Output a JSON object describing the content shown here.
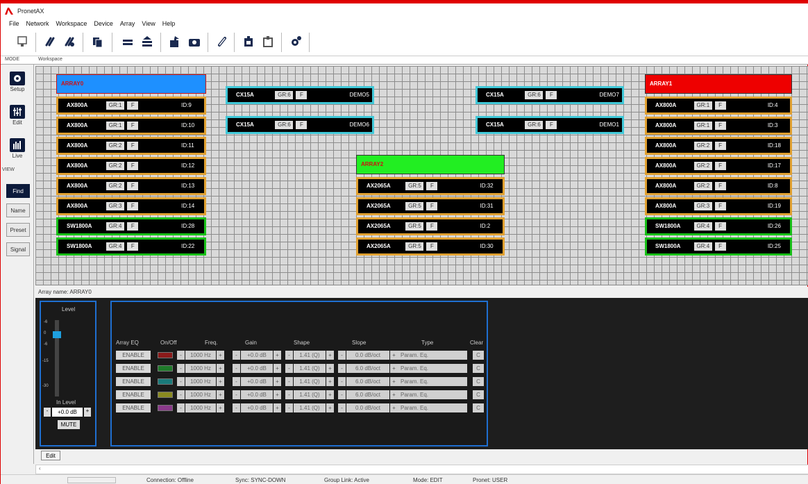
{
  "app": {
    "title": "PronetAX"
  },
  "menu": [
    "File",
    "Network",
    "Workspace",
    "Device",
    "Array",
    "View",
    "Help"
  ],
  "toolbar_icons": [
    "network-icon",
    "link-icon",
    "unlink-icon",
    "copy-icon",
    "stack-icon",
    "stack-up-icon",
    "export-icon",
    "camera-icon",
    "chain-icon",
    "device-icon",
    "device-out-icon",
    "settings-icon"
  ],
  "mode_label": "MODE",
  "workspace_label": "Workspace",
  "left": {
    "setup": "Setup",
    "edit": "Edit",
    "live": "Live",
    "view_label": "VIEW",
    "find": "Find",
    "name": "Name",
    "preset": "Preset",
    "signal": "Signal"
  },
  "arrays": {
    "array0": {
      "name": "ARRAY0",
      "color": "#1e90ff",
      "devices": [
        {
          "model": "AX800A",
          "gr": "GR:1",
          "f": "F",
          "id": "ID:9",
          "c": "or"
        },
        {
          "model": "AX800A",
          "gr": "GR:1",
          "f": "F",
          "id": "ID:10",
          "c": "or"
        },
        {
          "model": "AX800A",
          "gr": "GR:2",
          "f": "F",
          "id": "ID:11",
          "c": "or"
        },
        {
          "model": "AX800A",
          "gr": "GR:2",
          "f": "F",
          "id": "ID:12",
          "c": "or"
        },
        {
          "model": "AX800A",
          "gr": "GR:2",
          "f": "F",
          "id": "ID:13",
          "c": "or"
        },
        {
          "model": "AX800A",
          "gr": "GR:3",
          "f": "F",
          "id": "ID:14",
          "c": "or"
        },
        {
          "model": "SW1800A",
          "gr": "GR:4",
          "f": "F",
          "id": "ID:28",
          "c": "gn"
        },
        {
          "model": "SW1800A",
          "gr": "GR:4",
          "f": "F",
          "id": "ID:22",
          "c": "gn"
        }
      ]
    },
    "array1": {
      "name": "ARRAY1",
      "color": "#ee0000",
      "devices": [
        {
          "model": "AX800A",
          "gr": "GR:1",
          "f": "F",
          "id": "ID:4",
          "c": "or"
        },
        {
          "model": "AX800A",
          "gr": "GR:1",
          "f": "F",
          "id": "ID:3",
          "c": "or"
        },
        {
          "model": "AX800A",
          "gr": "GR:2",
          "f": "F",
          "id": "ID:18",
          "c": "or"
        },
        {
          "model": "AX800A",
          "gr": "GR:2",
          "f": "F",
          "id": "ID:17",
          "c": "or"
        },
        {
          "model": "AX800A",
          "gr": "GR:2",
          "f": "F",
          "id": "ID:8",
          "c": "or"
        },
        {
          "model": "AX800A",
          "gr": "GR:3",
          "f": "F",
          "id": "ID:19",
          "c": "or"
        },
        {
          "model": "SW1800A",
          "gr": "GR:4",
          "f": "F",
          "id": "ID:26",
          "c": "gn"
        },
        {
          "model": "SW1800A",
          "gr": "GR:4",
          "f": "F",
          "id": "ID:25",
          "c": "gn"
        }
      ]
    },
    "array2": {
      "name": "ARRAY2",
      "color": "#22ee22",
      "devices": [
        {
          "model": "AX2065A",
          "gr": "GR:5",
          "f": "F",
          "id": "ID:32",
          "c": "or"
        },
        {
          "model": "AX2065A",
          "gr": "GR:5",
          "f": "F",
          "id": "ID:31",
          "c": "or"
        },
        {
          "model": "AX2065A",
          "gr": "GR:5",
          "f": "F",
          "id": "ID:2",
          "c": "or"
        },
        {
          "model": "AX2065A",
          "gr": "GR:5",
          "f": "F",
          "id": "ID:30",
          "c": "or"
        }
      ]
    },
    "standalone": [
      {
        "model": "CX15A",
        "gr": "GR:6",
        "f": "F",
        "id": "DEMO5",
        "c": "cy"
      },
      {
        "model": "CX15A",
        "gr": "GR:6",
        "f": "F",
        "id": "DEMO6",
        "c": "cy"
      },
      {
        "model": "CX15A",
        "gr": "GR:6",
        "f": "F",
        "id": "DEMO7",
        "c": "cy"
      },
      {
        "model": "CX15A",
        "gr": "GR:6",
        "f": "F",
        "id": "DEMO1",
        "c": "cy"
      }
    ]
  },
  "array_name_label": "Array name: ARRAY0",
  "level": {
    "title": "Level",
    "scale": [
      "-6",
      "0",
      "-6",
      "-15",
      "-30"
    ],
    "in_level_label": "In Level",
    "in_level_value": "+0.0 dB",
    "mute": "MUTE",
    "minus": "-",
    "plus": "+"
  },
  "eq": {
    "headers": {
      "array_eq": "Array EQ",
      "onoff": "On/Off",
      "freq": "Freq.",
      "gain": "Gain",
      "shape": "Shape",
      "slope": "Slope",
      "type": "Type",
      "clear": "Clear"
    },
    "rows": [
      {
        "enable": "ENABLE",
        "color": "#8b1a1a",
        "freq": "1000 Hz",
        "gain": "+0.0 dB",
        "shape": "1.41 (Q)",
        "slope": "0.0 dB/oct",
        "type": "Param. Eq.",
        "clear": "C"
      },
      {
        "enable": "ENABLE",
        "color": "#1f7a2a",
        "freq": "1000 Hz",
        "gain": "+0.0 dB",
        "shape": "1.41 (Q)",
        "slope": "6.0 dB/oct",
        "type": "Param. Eq.",
        "clear": "C"
      },
      {
        "enable": "ENABLE",
        "color": "#1a7a7a",
        "freq": "1000 Hz",
        "gain": "+0.0 dB",
        "shape": "1.41 (Q)",
        "slope": "6.0 dB/oct",
        "type": "Param. Eq.",
        "clear": "C"
      },
      {
        "enable": "ENABLE",
        "color": "#8a8a20",
        "freq": "1000 Hz",
        "gain": "+0.0 dB",
        "shape": "1.41 (Q)",
        "slope": "6.0 dB/oct",
        "type": "Param. Eq.",
        "clear": "C"
      },
      {
        "enable": "ENABLE",
        "color": "#8a3a8a",
        "freq": "1000 Hz",
        "gain": "+0.0 dB",
        "shape": "1.41 (Q)",
        "slope": "0.0 dB/oct",
        "type": "Param. Eq.",
        "clear": "C"
      }
    ]
  },
  "tab": {
    "edit": "Edit"
  },
  "status": {
    "connection": "Connection: Offline",
    "sync": "Sync: SYNC-DOWN",
    "group_link": "Group Link: Active",
    "mode": "Mode: EDIT",
    "pronet": "Pronet: USER"
  }
}
